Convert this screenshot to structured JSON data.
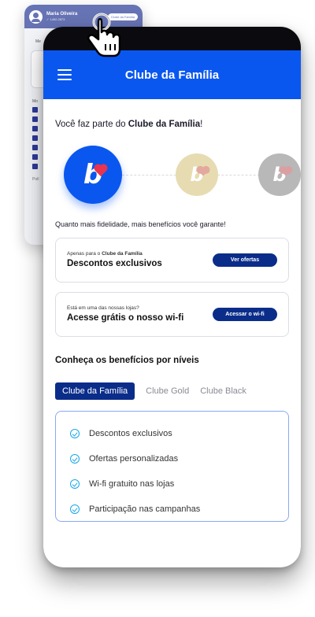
{
  "background_screen": {
    "user_name": "Maria Oliveira",
    "user_sub": "✓ 1492.2873",
    "club_badge": "Clube da Família",
    "menu_label": "Me",
    "section_label": "Mo",
    "footer_label": "Polí"
  },
  "header": {
    "title": "Clube da Família"
  },
  "intro": {
    "prefix": "Você faz parte do ",
    "club": "Clube da Família",
    "suffix": "!"
  },
  "levels": {
    "badge_letter": "b",
    "colors": {
      "active": "#0a57f0",
      "gold": "#e7dcb1",
      "black": "#b8b8b8",
      "heart": "#e8344e"
    }
  },
  "tagline": "Quanto mais fidelidade, mais benefícios você garante!",
  "offers": [
    {
      "sub_prefix": "Apenas para o ",
      "sub_bold": "Clube da Família",
      "title": "Descontos exclusivos",
      "button": "Ver ofertas"
    },
    {
      "sub_prefix": "Está em uma das nossas lojas?",
      "sub_bold": "",
      "title": "Acesse grátis o nosso wi-fi",
      "button": "Acessar o wi-fi"
    }
  ],
  "benefits_section": {
    "title": "Conheça os benefícios por níveis",
    "tabs": [
      "Clube da Família",
      "Clube Gold",
      "Clube Black"
    ],
    "active_tab": "Clube da Família",
    "items": [
      "Descontos exclusivos",
      "Ofertas personalizadas",
      "Wi-fi gratuito nas lojas",
      "Participação nas campanhas"
    ]
  }
}
